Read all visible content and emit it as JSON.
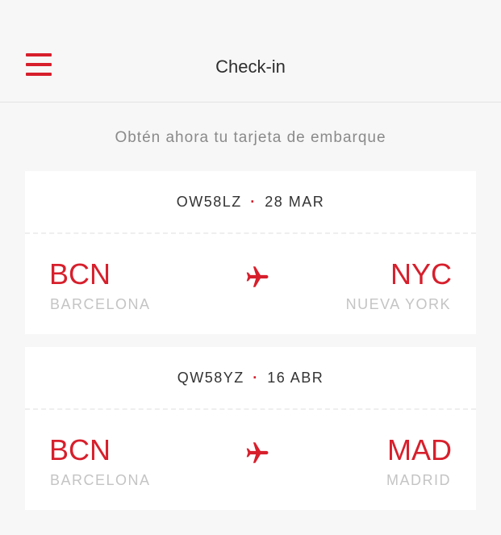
{
  "colors": {
    "accent": "#d71f2c",
    "background": "#f7f7f7",
    "card": "#ffffff",
    "text": "#2e2e2e",
    "muted": "#8a8a8a",
    "light": "#c4c4c4"
  },
  "header": {
    "title": "Check-in",
    "menu_icon": "hamburger-menu-icon"
  },
  "subtitle": "Obtén ahora tu tarjeta de embarque",
  "bookings": [
    {
      "reference": "OW58LZ",
      "separator": "·",
      "date": "28 MAR",
      "origin_code": "BCN",
      "origin_city": "BARCELONA",
      "destination_code": "NYC",
      "destination_city": "NUEVA YORK",
      "icon": "airplane-icon"
    },
    {
      "reference": "QW58YZ",
      "separator": "·",
      "date": "16 ABR",
      "origin_code": "BCN",
      "origin_city": "BARCELONA",
      "destination_code": "MAD",
      "destination_city": "MADRID",
      "icon": "airplane-icon"
    }
  ]
}
